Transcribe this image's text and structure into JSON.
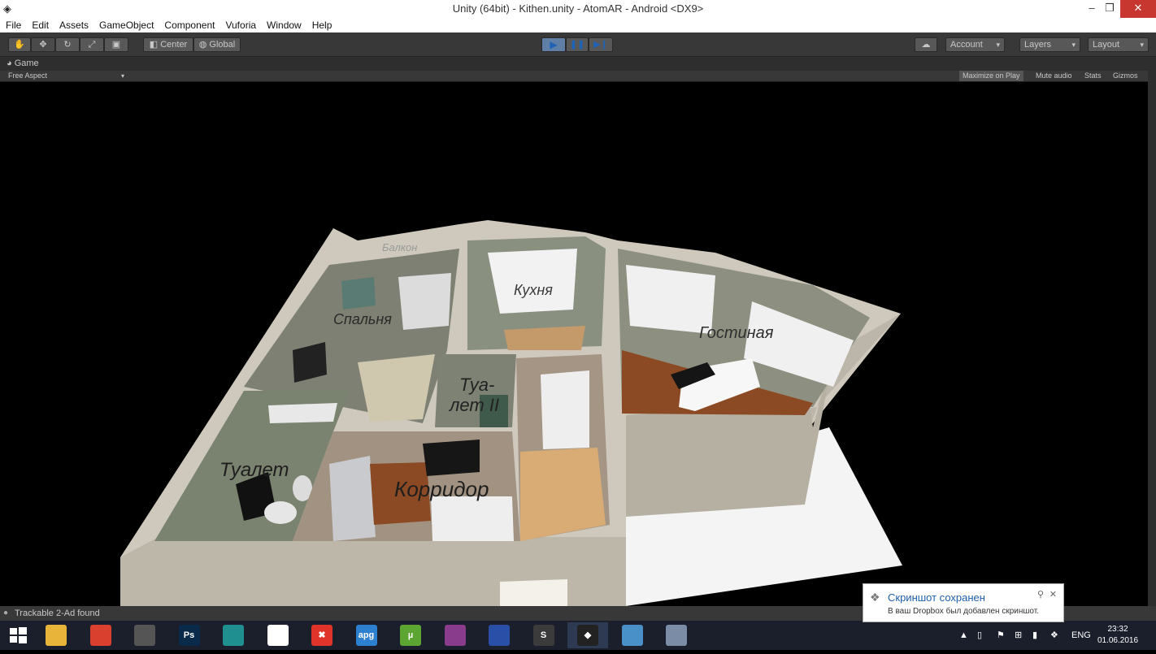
{
  "window": {
    "title": "Unity (64bit) - Kithen.unity - AtomAR - Android <DX9>",
    "minimize": "‒",
    "maximize": "❐",
    "close": "✕"
  },
  "menu": [
    "File",
    "Edit",
    "Assets",
    "GameObject",
    "Component",
    "Vuforia",
    "Window",
    "Help"
  ],
  "toolbar": {
    "pivot_label": "Center",
    "space_label": "Global",
    "account_label": "Account",
    "layers_label": "Layers",
    "layout_label": "Layout"
  },
  "game_tab": {
    "label": "Game",
    "aspect": "Free Aspect",
    "options": [
      "Maximize on Play",
      "Mute audio",
      "Stats",
      "Gizmos"
    ]
  },
  "scene": {
    "labels": [
      "Балкон",
      "Кухня",
      "Спальня",
      "Гостиная",
      "Туа-",
      "лет II",
      "Туалет",
      "Корридор"
    ]
  },
  "status": {
    "message": "Trackable 2-Ad found"
  },
  "taskbar": {
    "apps": [
      {
        "name": "file-explorer",
        "glyph": "",
        "color": "#e8b53a"
      },
      {
        "name": "chrome",
        "glyph": "",
        "color": "#d9412e"
      },
      {
        "name": "app-dark",
        "glyph": "",
        "color": "#555555"
      },
      {
        "name": "photoshop",
        "glyph": "Ps",
        "color": "#0a2a4a"
      },
      {
        "name": "3dsmax",
        "glyph": "",
        "color": "#1f8f8f"
      },
      {
        "name": "apps-grid",
        "glyph": "",
        "color": "#ffffff"
      },
      {
        "name": "xmind",
        "glyph": "✖",
        "color": "#e0342b"
      },
      {
        "name": "apg",
        "glyph": "apg",
        "color": "#2d7fd0"
      },
      {
        "name": "utorrent",
        "glyph": "µ",
        "color": "#5da532"
      },
      {
        "name": "winrar",
        "glyph": "",
        "color": "#8a3c8c"
      },
      {
        "name": "save-disk",
        "glyph": "",
        "color": "#2a4fa6"
      },
      {
        "name": "sublime",
        "glyph": "S",
        "color": "#3b3b3b"
      },
      {
        "name": "unity",
        "glyph": "◆",
        "color": "#222222"
      },
      {
        "name": "image-viewer",
        "glyph": "",
        "color": "#4a90c8"
      },
      {
        "name": "network-app",
        "glyph": "",
        "color": "#7a8ca6"
      }
    ],
    "lang": "ENG",
    "time": "23:32",
    "date": "01.06.2016"
  },
  "toast": {
    "title": "Скриншот сохранен",
    "body": "В ваш Dropbox был добавлен скриншот."
  }
}
